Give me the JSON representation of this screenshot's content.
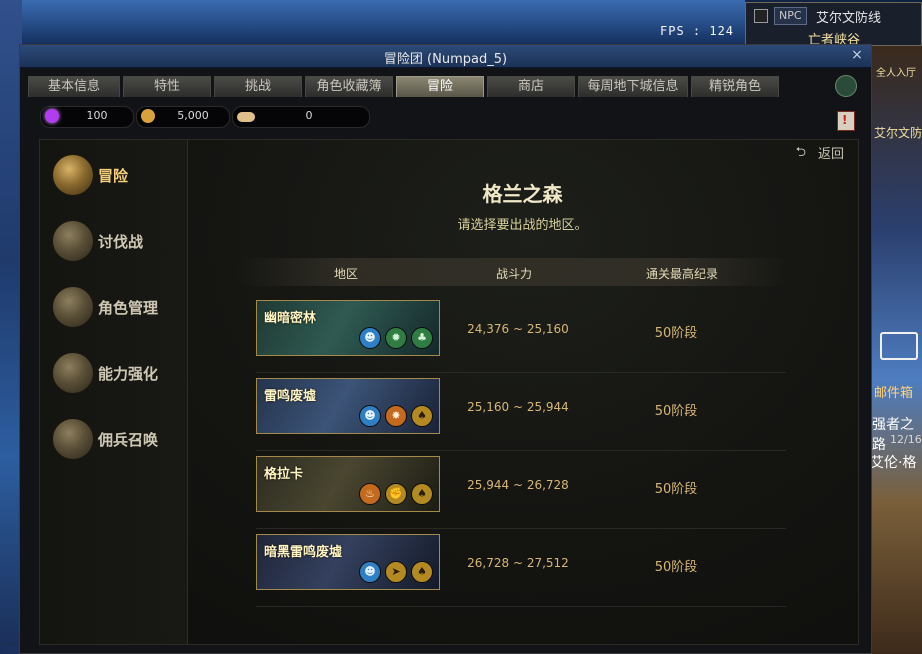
{
  "hud": {
    "fps": "FPS : 124",
    "npc_tag": "NPC",
    "npc_name": "艾尔文防线",
    "npc_sub": "亡者峡谷",
    "right_top": "全人入厅",
    "right_mid": "艾尔文防",
    "mail_label": "邮件箱",
    "strong_label": "强者之路",
    "date_label": "12/16",
    "ailun_label": "艾伦·格"
  },
  "window": {
    "title": "冒险团 (Numpad_5)",
    "close": "×"
  },
  "tabs": [
    {
      "label": "基本信息",
      "active": false
    },
    {
      "label": "特性",
      "active": false
    },
    {
      "label": "挑战",
      "active": false
    },
    {
      "label": "角色收藏簿",
      "active": false
    },
    {
      "label": "冒险",
      "active": true
    },
    {
      "label": "商店",
      "active": false
    },
    {
      "label": "每周地下城信息",
      "active": false
    },
    {
      "label": "精锐角色",
      "active": false
    }
  ],
  "currency": [
    {
      "icon": "purple-gem-icon",
      "value": "100",
      "color": "#b23cf0"
    },
    {
      "icon": "gold-coin-icon",
      "value": "5,000",
      "color": "#d9a23a"
    },
    {
      "icon": "coin-stack-icon",
      "value": "0",
      "color": "#e0c08a"
    }
  ],
  "sidebar": [
    {
      "label": "冒险",
      "icon": "adventure-book-icon",
      "active": true
    },
    {
      "label": "讨伐战",
      "icon": "crossed-swords-icon",
      "active": false
    },
    {
      "label": "角色管理",
      "icon": "character-face-icon",
      "active": false
    },
    {
      "label": "能力强化",
      "icon": "spiked-star-icon",
      "active": false
    },
    {
      "label": "佣兵召唤",
      "icon": "treasure-chest-icon",
      "active": false
    }
  ],
  "back_label": "返回",
  "map": {
    "title": "格兰之森",
    "subtitle": "请选择要出战的地区。"
  },
  "table": {
    "headers": [
      "地区",
      "战斗力",
      "通关最高纪录"
    ],
    "rows": [
      {
        "name": "幽暗密林",
        "power": "24,376 ~ 25,160",
        "record": "50阶段",
        "bg": "#2a4a44",
        "badges": [
          {
            "icon": "blue-face-badge-icon",
            "color": "#2e7fc4",
            "glyph": "☻"
          },
          {
            "icon": "green-gear-badge-icon",
            "color": "#2f7d43",
            "glyph": "✹"
          },
          {
            "icon": "green-club-badge-icon",
            "color": "#2f7d43",
            "glyph": "♣"
          }
        ]
      },
      {
        "name": "雷鸣废墟",
        "power": "25,160 ~ 25,944",
        "record": "50阶段",
        "bg": "#2b3e57",
        "badges": [
          {
            "icon": "blue-face-badge-icon",
            "color": "#2e7fc4",
            "glyph": "☻"
          },
          {
            "icon": "orange-spark-badge-icon",
            "color": "#c46a1f",
            "glyph": "✸"
          },
          {
            "icon": "gold-spade-badge-icon",
            "color": "#b38a22",
            "glyph": "♠"
          }
        ]
      },
      {
        "name": "格拉卡",
        "power": "25,944 ~ 26,728",
        "record": "50阶段",
        "bg": "#3a3a2a",
        "badges": [
          {
            "icon": "orange-claw-badge-icon",
            "color": "#c46a1f",
            "glyph": "♨"
          },
          {
            "icon": "gold-fist-badge-icon",
            "color": "#b38a22",
            "glyph": "✊"
          },
          {
            "icon": "gold-spade-badge-icon",
            "color": "#b38a22",
            "glyph": "♠"
          }
        ]
      },
      {
        "name": "暗黑雷鸣废墟",
        "power": "26,728 ~ 27,512",
        "record": "50阶段",
        "bg": "#283048",
        "badges": [
          {
            "icon": "blue-face-badge-icon",
            "color": "#2e7fc4",
            "glyph": "☻"
          },
          {
            "icon": "gold-arrow-badge-icon",
            "color": "#b38a22",
            "glyph": "➤"
          },
          {
            "icon": "gold-spade-badge-icon",
            "color": "#b38a22",
            "glyph": "♠"
          }
        ]
      }
    ]
  }
}
